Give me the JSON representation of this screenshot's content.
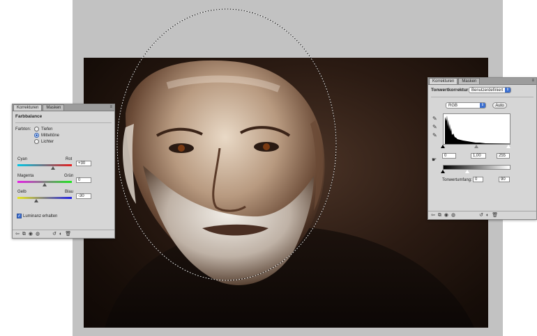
{
  "left_panel": {
    "tabs": [
      "Korrekturen",
      "Masken"
    ],
    "menu_icon": "≡",
    "title": "Farbbalance",
    "farbton_label": "Farbton:",
    "tones": [
      "Tiefen",
      "Mitteltöne",
      "Lichter"
    ],
    "selected_tone": "Mitteltöne",
    "sliders": [
      {
        "left": "Cyan",
        "right": "Rot",
        "value": "+30",
        "level": 0.65,
        "gradient": [
          "#00c8e6",
          "#e61e1e"
        ]
      },
      {
        "left": "Magenta",
        "right": "Grün",
        "value": "0",
        "level": 0.5,
        "gradient": [
          "#e61ee6",
          "#1ee61e"
        ]
      },
      {
        "left": "Gelb",
        "right": "Blau",
        "value": "-30",
        "level": 0.35,
        "gradient": [
          "#e6e61e",
          "#1e1ee6"
        ]
      }
    ],
    "luminanz_label": "Luminanz erhalten",
    "luminanz_checked": true,
    "footer_icons": [
      "back-arrow-icon",
      "layer-clip-icon",
      "visibility-eye-icon",
      "view-previous-icon",
      "reset-icon",
      "toggle-layer-icon",
      "delete-trash-icon"
    ]
  },
  "right_panel": {
    "tabs": [
      "Korrekturen",
      "Masken"
    ],
    "menu_icon": "≡",
    "title": "Tonwertkorrektur",
    "preset": "Benutzerdefiniert",
    "channel": "RGB",
    "auto_label": "Auto",
    "input_levels": [
      "0",
      "1,00",
      "255"
    ],
    "output_label": "Tonwertumfang:",
    "output_levels": [
      "0",
      "90"
    ],
    "footer_icons": [
      "back-arrow-icon",
      "layer-clip-icon",
      "visibility-eye-icon",
      "view-previous-icon",
      "reset-icon",
      "toggle-layer-icon",
      "delete-trash-icon"
    ]
  },
  "colors": {
    "canvas_bg": "#c2c2c2",
    "panel_bg": "#d6d6d6",
    "accent": "#3b6fd0",
    "photo_sepia": "#2a1a12"
  }
}
